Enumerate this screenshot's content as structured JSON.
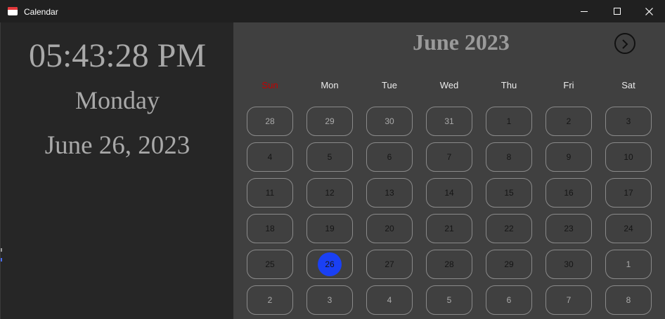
{
  "window": {
    "title": "Calendar",
    "icon": "calendar-app-icon",
    "controls": [
      "minimize-icon",
      "maximize-icon",
      "close-icon"
    ]
  },
  "clock_panel": {
    "time": "05:43:28 PM",
    "weekday": "Monday",
    "date": "June 26, 2023"
  },
  "calendar": {
    "month_title": "June 2023",
    "next_button_icon": "chevron-right-icon",
    "weekdays": [
      "Sun",
      "Mon",
      "Tue",
      "Wed",
      "Thu",
      "Fri",
      "Sat"
    ],
    "days": [
      {
        "label": "28",
        "in_month": false,
        "today": false
      },
      {
        "label": "29",
        "in_month": false,
        "today": false
      },
      {
        "label": "30",
        "in_month": false,
        "today": false
      },
      {
        "label": "31",
        "in_month": false,
        "today": false
      },
      {
        "label": "1",
        "in_month": true,
        "today": false
      },
      {
        "label": "2",
        "in_month": true,
        "today": false
      },
      {
        "label": "3",
        "in_month": true,
        "today": false
      },
      {
        "label": "4",
        "in_month": true,
        "today": false
      },
      {
        "label": "5",
        "in_month": true,
        "today": false
      },
      {
        "label": "6",
        "in_month": true,
        "today": false
      },
      {
        "label": "7",
        "in_month": true,
        "today": false
      },
      {
        "label": "8",
        "in_month": true,
        "today": false
      },
      {
        "label": "9",
        "in_month": true,
        "today": false
      },
      {
        "label": "10",
        "in_month": true,
        "today": false
      },
      {
        "label": "11",
        "in_month": true,
        "today": false
      },
      {
        "label": "12",
        "in_month": true,
        "today": false
      },
      {
        "label": "13",
        "in_month": true,
        "today": false
      },
      {
        "label": "14",
        "in_month": true,
        "today": false
      },
      {
        "label": "15",
        "in_month": true,
        "today": false
      },
      {
        "label": "16",
        "in_month": true,
        "today": false
      },
      {
        "label": "17",
        "in_month": true,
        "today": false
      },
      {
        "label": "18",
        "in_month": true,
        "today": false
      },
      {
        "label": "19",
        "in_month": true,
        "today": false
      },
      {
        "label": "20",
        "in_month": true,
        "today": false
      },
      {
        "label": "21",
        "in_month": true,
        "today": false
      },
      {
        "label": "22",
        "in_month": true,
        "today": false
      },
      {
        "label": "23",
        "in_month": true,
        "today": false
      },
      {
        "label": "24",
        "in_month": true,
        "today": false
      },
      {
        "label": "25",
        "in_month": true,
        "today": false
      },
      {
        "label": "26",
        "in_month": true,
        "today": true
      },
      {
        "label": "27",
        "in_month": true,
        "today": false
      },
      {
        "label": "28",
        "in_month": true,
        "today": false
      },
      {
        "label": "29",
        "in_month": true,
        "today": false
      },
      {
        "label": "30",
        "in_month": true,
        "today": false
      },
      {
        "label": "1",
        "in_month": false,
        "today": false
      },
      {
        "label": "2",
        "in_month": false,
        "today": false
      },
      {
        "label": "3",
        "in_month": false,
        "today": false
      },
      {
        "label": "4",
        "in_month": false,
        "today": false
      },
      {
        "label": "5",
        "in_month": false,
        "today": false
      },
      {
        "label": "6",
        "in_month": false,
        "today": false
      },
      {
        "label": "7",
        "in_month": false,
        "today": false
      },
      {
        "label": "8",
        "in_month": false,
        "today": false
      }
    ]
  },
  "colors": {
    "titlebar": "#202020",
    "left_panel": "#262626",
    "right_panel": "#404040",
    "clock_text": "#a9a9a9",
    "sunday_header": "#c40000",
    "today_highlight": "#1a40f4",
    "cell_border": "#8a8a8a"
  }
}
